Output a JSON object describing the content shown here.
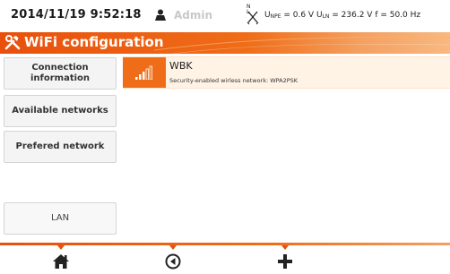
{
  "status": {
    "datetime": "2014/11/19 9:52:18",
    "user": "Admin",
    "nl_label": "N L",
    "measurement": {
      "u": "U",
      "npe_sub": "NPE",
      "npe_value": " = 0.6 V ",
      "ln_sub": "LN",
      "ln_value": " = 236.2 V ",
      "freq": "f = 50.0 Hz"
    }
  },
  "title": "WiFi configuration",
  "menu": {
    "items": [
      {
        "label": "Connection information"
      },
      {
        "label": "Available networks"
      },
      {
        "label": "Prefered network"
      }
    ],
    "lan_label": "LAN"
  },
  "networks": [
    {
      "name": "WBK",
      "security": "Security-enabled wirless network: WPA2PSK",
      "signal_icon": "wifi-signal-icon"
    }
  ],
  "footer": {
    "icons": [
      "home-icon",
      "back-icon",
      "add-icon"
    ]
  },
  "colors": {
    "accent": "#ef6d18",
    "accent_dark": "#e8500c",
    "row_highlight": "#fff3e6"
  }
}
